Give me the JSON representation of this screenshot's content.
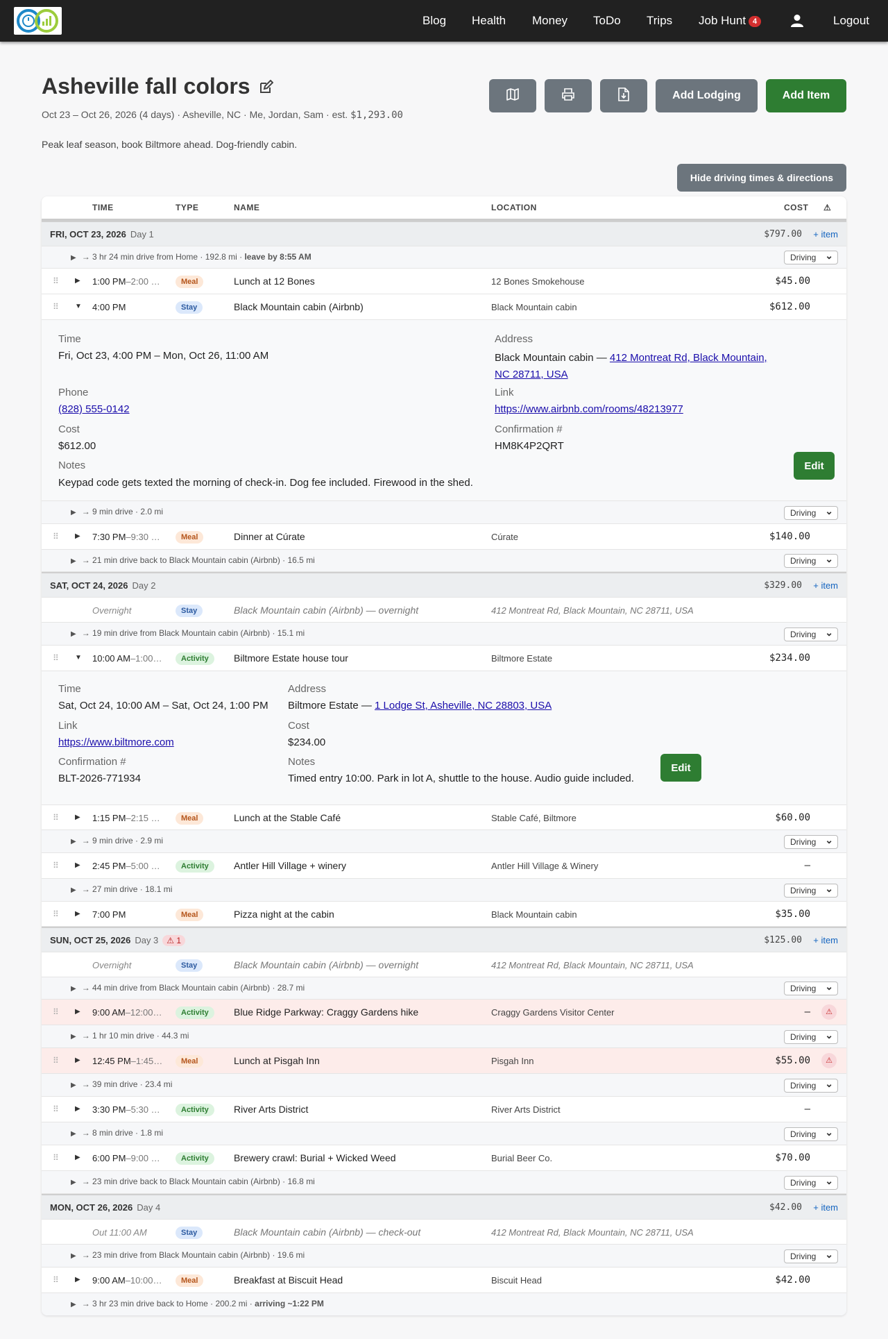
{
  "nav": {
    "items": [
      "Blog",
      "Health",
      "Money",
      "ToDo",
      "Trips",
      "Job Hunt"
    ],
    "job_hunt_badge": "4",
    "logout": "Logout"
  },
  "trip": {
    "title": "Asheville fall colors",
    "subtitle_prefix": "Oct 23 – Oct 26, 2026 (4 days) · Asheville, NC · Me, Jordan, Sam · est. ",
    "subtitle_cost": "$1,293.00",
    "description": "Peak leaf season, book Biltmore ahead. Dog-friendly cabin."
  },
  "actions": {
    "add_lodging": "Add Lodging",
    "add_item": "Add Item",
    "hide_driving": "Hide driving times & directions"
  },
  "columns": {
    "time": "TIME",
    "type": "TYPE",
    "name": "NAME",
    "location": "LOCATION",
    "cost": "COST",
    "warn": "⚠"
  },
  "add_item_label": "+ item",
  "driving_label": "Driving",
  "days": [
    {
      "label": "FRI, OCT 23, 2026",
      "num": "Day 1",
      "cost": "$797.00"
    },
    {
      "label": "SAT, OCT 24, 2026",
      "num": "Day 2",
      "cost": "$329.00"
    },
    {
      "label": "SUN, OCT 25, 2026",
      "num": "Day 3",
      "cost": "$125.00",
      "warn": "⚠ 1"
    },
    {
      "label": "MON, OCT 26, 2026",
      "num": "Day 4",
      "cost": "$42.00"
    }
  ],
  "drives": [
    {
      "text": "→ 3 hr 24 min drive from Home · 192.8 mi · ",
      "bold": "leave by 8:55 AM"
    },
    {
      "text": "→ 9 min drive · 2.0 mi"
    },
    {
      "text": "→ 21 min drive back to Black Mountain cabin (Airbnb) · 16.5 mi"
    },
    {
      "text": "→ 19 min drive from Black Mountain cabin (Airbnb) · 15.1 mi"
    },
    {
      "text": "→ 9 min drive · 2.9 mi"
    },
    {
      "text": "→ 27 min drive · 18.1 mi"
    },
    {
      "text": "→ 44 min drive from Black Mountain cabin (Airbnb) · 28.7 mi"
    },
    {
      "text": "→ 1 hr 10 min drive · 44.3 mi"
    },
    {
      "text": "→ 39 min drive · 23.4 mi"
    },
    {
      "text": "→ 8 min drive · 1.8 mi"
    },
    {
      "text": "→ 23 min drive back to Black Mountain cabin (Airbnb) · 16.8 mi"
    },
    {
      "text": "→ 23 min drive from Black Mountain cabin (Airbnb) · 19.6 mi"
    },
    {
      "text": "→ 3 hr 23 min drive back to Home · 200.2 mi · ",
      "bold": "arriving ~1:22 PM"
    }
  ],
  "items": [
    {
      "time": "1:00 PM",
      "end": "–2:00 …",
      "type": "Meal",
      "name": "Lunch at 12 Bones",
      "location": "12 Bones Smokehouse",
      "cost": "$45.00"
    },
    {
      "time": "4:00 PM",
      "end": "",
      "type": "Stay",
      "name": "Black Mountain cabin (Airbnb)",
      "location": "Black Mountain cabin",
      "cost": "$612.00"
    },
    {
      "time": "7:30 PM",
      "end": "–9:30 …",
      "type": "Meal",
      "name": "Dinner at Cúrate",
      "location": "Cúrate",
      "cost": "$140.00"
    },
    {
      "time": "Overnight",
      "end": "",
      "type": "Stay",
      "name": "Black Mountain cabin (Airbnb) — overnight",
      "location": "412 Montreat Rd, Black Mountain, NC 28711, USA",
      "cost": ""
    },
    {
      "time": "10:00 AM",
      "end": "–1:00…",
      "type": "Activity",
      "name": "Biltmore Estate house tour",
      "location": "Biltmore Estate",
      "cost": "$234.00"
    },
    {
      "time": "1:15 PM",
      "end": "–2:15 …",
      "type": "Meal",
      "name": "Lunch at the Stable Café",
      "location": "Stable Café, Biltmore",
      "cost": "$60.00"
    },
    {
      "time": "2:45 PM",
      "end": "–5:00 …",
      "type": "Activity",
      "name": "Antler Hill Village + winery",
      "location": "Antler Hill Village & Winery",
      "cost": "–"
    },
    {
      "time": "7:00 PM",
      "end": "",
      "type": "Meal",
      "name": "Pizza night at the cabin",
      "location": "Black Mountain cabin",
      "cost": "$35.00"
    },
    {
      "time": "Overnight",
      "end": "",
      "type": "Stay",
      "name": "Black Mountain cabin (Airbnb) — overnight",
      "location": "412 Montreat Rd, Black Mountain, NC 28711, USA",
      "cost": ""
    },
    {
      "time": "9:00 AM",
      "end": "–12:00…",
      "type": "Activity",
      "name": "Blue Ridge Parkway: Craggy Gardens hike",
      "location": "Craggy Gardens Visitor Center",
      "cost": "–"
    },
    {
      "time": "12:45 PM",
      "end": "–1:45…",
      "type": "Meal",
      "name": "Lunch at Pisgah Inn",
      "location": "Pisgah Inn",
      "cost": "$55.00"
    },
    {
      "time": "3:30 PM",
      "end": "–5:30 …",
      "type": "Activity",
      "name": "River Arts District",
      "location": "River Arts District",
      "cost": "–"
    },
    {
      "time": "6:00 PM",
      "end": "–9:00 …",
      "type": "Activity",
      "name": "Brewery crawl: Burial + Wicked Weed",
      "location": "Burial Beer Co.",
      "cost": "$70.00"
    },
    {
      "time": "Out 11:00 AM",
      "end": "",
      "type": "Stay",
      "name": "Black Mountain cabin (Airbnb) — check-out",
      "location": "412 Montreat Rd, Black Mountain, NC 28711, USA",
      "cost": ""
    },
    {
      "time": "9:00 AM",
      "end": "–10:00…",
      "type": "Meal",
      "name": "Breakfast at Biscuit Head",
      "location": "Biscuit Head",
      "cost": "$42.00"
    }
  ],
  "detail_cabin": {
    "time_label": "Time",
    "time": "Fri, Oct 23, 4:00 PM – Mon, Oct 26, 11:00 AM",
    "address_label": "Address",
    "address_prefix": "Black Mountain cabin — ",
    "address_link_1": "412 Montreat Rd, Black Mountain,",
    "address_link_2": "NC 28711, USA",
    "phone_label": "Phone",
    "phone": "(828) 555-0142",
    "link_label": "Link",
    "link": "https://www.airbnb.com/rooms/48213977",
    "cost_label": "Cost",
    "cost": "$612.00",
    "conf_label": "Confirmation #",
    "conf": "HM8K4P2QRT",
    "notes_label": "Notes",
    "notes": "Keypad code gets texted the morning of check-in. Dog fee included. Firewood in the shed.",
    "edit": "Edit"
  },
  "detail_biltmore": {
    "time_label": "Time",
    "time": "Sat, Oct 24, 10:00 AM – Sat, Oct 24, 1:00 PM",
    "address_label": "Address",
    "address_prefix": "Biltmore Estate — ",
    "address_link": "1 Lodge St, Asheville, NC 28803, USA",
    "link_label": "Link",
    "link": "https://www.biltmore.com",
    "cost_label": "Cost",
    "cost": "$234.00",
    "conf_label": "Confirmation #",
    "conf": "BLT-2026-771934",
    "notes_label": "Notes",
    "notes": "Timed entry 10:00. Park in lot A, shuttle to the house. Audio guide included.",
    "edit": "Edit"
  },
  "colors": {
    "nav_bg": "#212121",
    "primary_green": "#2e7d32",
    "secondary_gray": "#6c757d",
    "badge_red": "#d32f2f"
  }
}
